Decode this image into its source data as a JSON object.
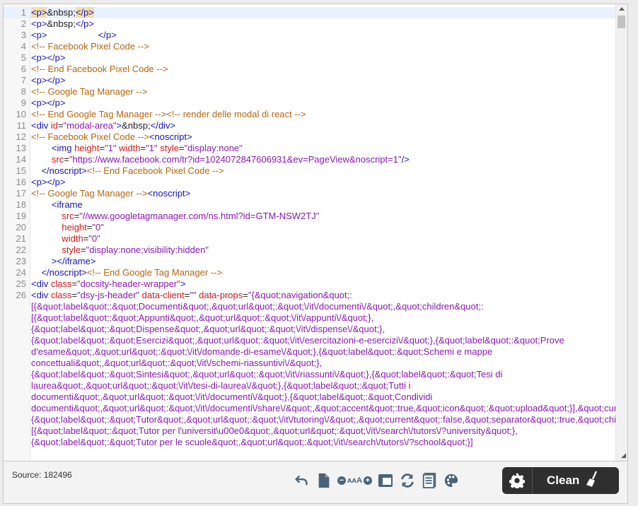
{
  "editor": {
    "lines": [
      {
        "n": "1",
        "html": "<span class=\"t hl\">&lt;p&gt;</span><span class=\"ent\">&amp;nbsp;</span><span class=\"t hl\">&lt;/p&gt;</span>",
        "active": true
      },
      {
        "n": "2",
        "html": "<span class=\"t\">&lt;p&gt;</span>&amp;nbsp;<span class=\"t\">&lt;/p&gt;</span>"
      },
      {
        "n": "3",
        "html": "<span class=\"t\">&lt;p&gt;</span>&nbsp;&nbsp;&nbsp;&nbsp;&nbsp;&nbsp;&nbsp;&nbsp;&nbsp;&nbsp;&nbsp;&nbsp;&nbsp;&nbsp;&nbsp;&nbsp;&nbsp;&nbsp;&nbsp;&nbsp;<span class=\"t\">&lt;/p&gt;</span>"
      },
      {
        "n": "4",
        "html": "<span class=\"c\">&lt;!-- Facebook Pixel Code --&gt;</span>"
      },
      {
        "n": "5",
        "html": "<span class=\"t\">&lt;p&gt;&lt;/p&gt;</span>"
      },
      {
        "n": "6",
        "html": "<span class=\"c\">&lt;!-- End Facebook Pixel Code --&gt;</span>"
      },
      {
        "n": "7",
        "html": "<span class=\"t\">&lt;p&gt;&lt;/p&gt;</span>"
      },
      {
        "n": "8",
        "html": "<span class=\"c\">&lt;!-- Google Tag Manager --&gt;</span>"
      },
      {
        "n": "9",
        "html": "<span class=\"t\">&lt;p&gt;&lt;/p&gt;</span>"
      },
      {
        "n": "10",
        "html": "<span class=\"c\">&lt;!-- End Google Tag Manager --&gt;&lt;!-- render delle modal di react --&gt;</span>"
      },
      {
        "n": "11",
        "html": "<span class=\"t\">&lt;div </span><span class=\"a\">id</span>=<span class=\"v\">\"modal-area\"</span><span class=\"t\">&gt;</span>&amp;nbsp;<span class=\"t\">&lt;/div&gt;</span>"
      },
      {
        "n": "12",
        "html": "<span class=\"c\">&lt;!-- Facebook Pixel Code --&gt;</span><span class=\"t\">&lt;noscript&gt;</span>"
      },
      {
        "n": "13",
        "html": "&nbsp;&nbsp;&nbsp;&nbsp;&nbsp;&nbsp;&nbsp;&nbsp;<span class=\"t\">&lt;img </span><span class=\"a\">height</span>=<span class=\"v\">\"1\"</span> <span class=\"a\">width</span>=<span class=\"v\">\"1\"</span> <span class=\"a\">style</span>=<span class=\"v\">\"display:none\"</span>"
      },
      {
        "n": "14",
        "html": "&nbsp;&nbsp;&nbsp;&nbsp;&nbsp;&nbsp;&nbsp;&nbsp;<span class=\"a\">src</span>=<span class=\"v\">\"https://www.facebook.com/tr?id=1024072847606931&amp;ev=PageView&amp;noscript=1\"</span><span class=\"t\">/&gt;</span>"
      },
      {
        "n": "15",
        "html": "&nbsp;&nbsp;&nbsp;&nbsp;<span class=\"t\">&lt;/noscript&gt;</span><span class=\"c\">&lt;!-- End Facebook Pixel Code --&gt;</span>"
      },
      {
        "n": "16",
        "html": "<span class=\"t\">&lt;p&gt;&lt;/p&gt;</span>"
      },
      {
        "n": "17",
        "html": "<span class=\"c\">&lt;!-- Google Tag Manager --&gt;</span><span class=\"t\">&lt;noscript&gt;</span>"
      },
      {
        "n": "18",
        "html": "&nbsp;&nbsp;&nbsp;&nbsp;&nbsp;&nbsp;&nbsp;&nbsp;<span class=\"t\">&lt;iframe</span>"
      },
      {
        "n": "19",
        "html": "&nbsp;&nbsp;&nbsp;&nbsp;&nbsp;&nbsp;&nbsp;&nbsp;&nbsp;&nbsp;&nbsp;&nbsp;<span class=\"a\">src</span>=<span class=\"v\">\"//www.googletagmanager.com/ns.html?id=GTM-NSW2TJ\"</span>"
      },
      {
        "n": "20",
        "html": "&nbsp;&nbsp;&nbsp;&nbsp;&nbsp;&nbsp;&nbsp;&nbsp;&nbsp;&nbsp;&nbsp;&nbsp;<span class=\"a\">height</span>=<span class=\"v\">\"0\"</span>"
      },
      {
        "n": "21",
        "html": "&nbsp;&nbsp;&nbsp;&nbsp;&nbsp;&nbsp;&nbsp;&nbsp;&nbsp;&nbsp;&nbsp;&nbsp;<span class=\"a\">width</span>=<span class=\"v\">\"0\"</span>"
      },
      {
        "n": "22",
        "html": "&nbsp;&nbsp;&nbsp;&nbsp;&nbsp;&nbsp;&nbsp;&nbsp;&nbsp;&nbsp;&nbsp;&nbsp;<span class=\"a\">style</span>=<span class=\"v\">\"display:none;visibility:hidden\"</span>"
      },
      {
        "n": "23",
        "html": "&nbsp;&nbsp;&nbsp;&nbsp;&nbsp;&nbsp;&nbsp;&nbsp;<span class=\"t\">&gt;&lt;/iframe&gt;</span>"
      },
      {
        "n": "24",
        "html": "&nbsp;&nbsp;&nbsp;&nbsp;<span class=\"t\">&lt;/noscript&gt;</span><span class=\"c\">&lt;!-- End Google Tag Manager --&gt;</span>"
      },
      {
        "n": "25",
        "html": "<span class=\"t\">&lt;div </span><span class=\"a\">class</span>=<span class=\"v\">\"docsity-header-wrapper\"</span><span class=\"t\">&gt;</span>"
      },
      {
        "n": "26",
        "wrap": true,
        "html": "<span class=\"t\">&lt;div </span><span class=\"a\">class</span>=<span class=\"v\">\"dsy-js-header\"</span> <span class=\"a\">data-client</span>=<span class=\"v\">\"\"</span> <span class=\"a\">data-props</span>=<span class=\"v\">\"{&amp;quot;navigation&amp;quot;:[{&amp;quot;label&amp;quot;:&amp;quot;Documenti&amp;quot;,&amp;quot;url&amp;quot;:&amp;quot;\\/it\\/documenti\\/&amp;quot;,&amp;quot;children&amp;quot;:[{&amp;quot;label&amp;quot;:&amp;quot;Appunti&amp;quot;,&amp;quot;url&amp;quot;:&amp;quot;\\/it\\/appunti\\/&amp;quot;},{&amp;quot;label&amp;quot;:&amp;quot;Dispense&amp;quot;,&amp;quot;url&amp;quot;:&amp;quot;\\/it\\/dispense\\/&amp;quot;},{&amp;quot;label&amp;quot;:&amp;quot;Esercizi&amp;quot;,&amp;quot;url&amp;quot;:&amp;quot;\\/it\\/esercitazioni-e-esercizi\\/&amp;quot;},{&amp;quot;label&amp;quot;:&amp;quot;Prove d'esame&amp;quot;,&amp;quot;url&amp;quot;:&amp;quot;\\/it\\/domande-di-esame\\/&amp;quot;},{&amp;quot;label&amp;quot;:&amp;quot;Schemi e mappe concettuali&amp;quot;,&amp;quot;url&amp;quot;:&amp;quot;\\/it\\/schemi-riassuntivi\\/&amp;quot;},{&amp;quot;label&amp;quot;:&amp;quot;Sintesi&amp;quot;,&amp;quot;url&amp;quot;:&amp;quot;\\/it\\/riassunti\\/&amp;quot;},{&amp;quot;label&amp;quot;:&amp;quot;Tesi di laurea&amp;quot;,&amp;quot;url&amp;quot;:&amp;quot;\\/it\\/tesi-di-laurea\\/&amp;quot;},{&amp;quot;label&amp;quot;:&amp;quot;Tutti i documenti&amp;quot;,&amp;quot;url&amp;quot;:&amp;quot;\\/it\\/documenti\\/&amp;quot;},{&amp;quot;label&amp;quot;:&amp;quot;Condividi documenti&amp;quot;,&amp;quot;url&amp;quot;:&amp;quot;\\/it\\/documenti\\/share\\/&amp;quot;,&amp;quot;accent&amp;quot;:true,&amp;quot;icon&amp;quot;:&amp;quot;upload&amp;quot;}],&amp;quot;current&amp;quot;:false,&amp;quot;separator&amp;quot;:true},{&amp;quot;label&amp;quot;:&amp;quot;Tutor&amp;quot;,&amp;quot;url&amp;quot;:&amp;quot;\\/it\\/tutoring\\/&amp;quot;,&amp;quot;current&amp;quot;:false,&amp;quot;separator&amp;quot;:true,&amp;quot;children&amp;quot;:[{&amp;quot;label&amp;quot;:&amp;quot;Tutor per l'universit\\u00e0&amp;quot;,&amp;quot;url&amp;quot;:&amp;quot;\\/it\\/search\\/tutors\\/?university&amp;quot;},{&amp;quot;label&amp;quot;:&amp;quot;Tutor per le scuole&amp;quot;,&amp;quot;url&amp;quot;:&amp;quot;\\/it\\/search\\/tutors\\/?school&amp;quot;}]</span>"
      }
    ]
  },
  "footer": {
    "source_label": "Source: 182496",
    "clean_label": "Clean"
  },
  "icons": [
    "undo-icon",
    "new-document-icon",
    "font-decrease-icon",
    "font-increase-icon",
    "maximize-icon",
    "refresh-icon",
    "notes-icon",
    "palette-icon",
    "gear-icon",
    "broom-icon"
  ]
}
